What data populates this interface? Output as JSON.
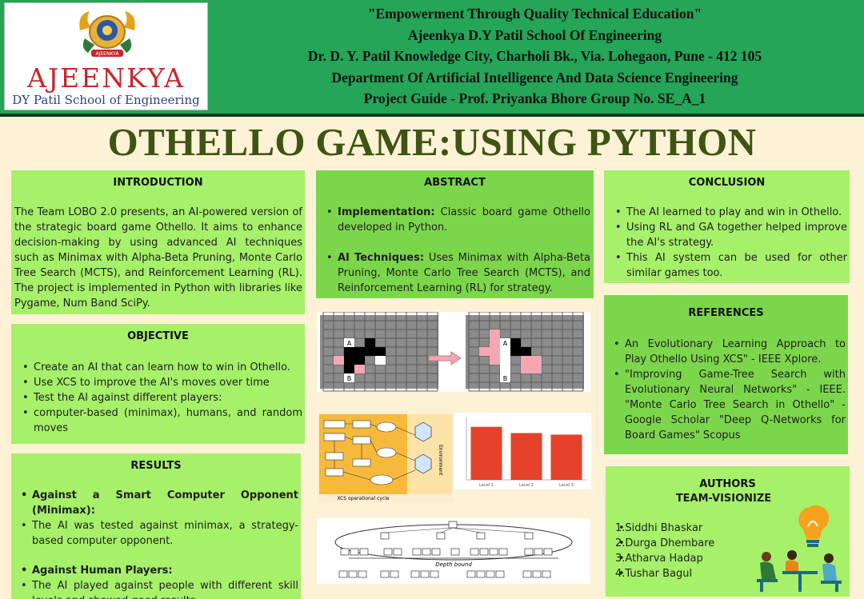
{
  "header": {
    "logo": {
      "brand": "AJEENKYA",
      "subtitle": "DY Patil School of Engineering",
      "badge_text": "AJEENKYA"
    },
    "lines": [
      "\"Empowerment Through Quality Technical Education\"",
      "Ajeenkya D.Y Patil School Of Engineering",
      "Dr. D. Y. Patil Knowledge City, Charholi Bk., Via. Lohegaon, Pune - 412 105",
      "Department Of Artificial Intelligence And Data Science Engineering",
      "Project Guide - Prof. Priyanka Bhore Group No. SE_A_1"
    ]
  },
  "title": "OTHELLO GAME:USING PYTHON",
  "introduction": {
    "heading": "INTRODUCTION",
    "text": "The Team LOBO 2.0 presents, an AI-powered version of the strategic board game Othello. It aims to enhance decision-making by using advanced AI techniques such as Minimax with Alpha-Beta Pruning, Monte Carlo Tree Search (MCTS), and Reinforcement Learning (RL). The project is implemented in Python with libraries like Pygame, Num Band SciPy."
  },
  "objective": {
    "heading": "OBJECTIVE",
    "items": [
      "Create an AI that can learn how to win in Othello.",
      "Use XCS to improve the AI's moves over time",
      "Test the AI against different players:",
      "computer-based (minimax), humans, and random moves"
    ]
  },
  "results": {
    "heading": "RESULTS",
    "groups": [
      {
        "title": "Against a Smart Computer Opponent (Minimax):",
        "detail": "The AI was tested against minimax, a strategy-based computer opponent."
      },
      {
        "title": "Against Human Players:",
        "detail": "The AI played against people with different skill levels and showed good results."
      }
    ]
  },
  "abstract": {
    "heading": "ABSTRACT",
    "items": [
      {
        "label": "Implementation:",
        "text": " Classic board game Othello developed in Python."
      },
      {
        "label": "AI Techniques:",
        "text": " Uses Minimax with Alpha-Beta Pruning, Monte Carlo Tree Search (MCTS), and Reinforcement Learning (RL) for strategy."
      }
    ]
  },
  "conclusion": {
    "heading": "CONCLUSION",
    "items": [
      "The AI learned to play and win in Othello.",
      "Using RL and GA together helped improve the AI's strategy.",
      "This AI system can be used for other similar games too."
    ]
  },
  "references": {
    "heading": "REFERENCES",
    "items": [
      "An Evolutionary Learning Approach to Play Othello Using XCS\" - IEEE Xplore.",
      "\"Improving Game-Tree Search with Evolutionary Neural Networks\" - IEEE. \"Monte Carlo Tree Search in Othello\" - Google Scholar \"Deep Q-Networks for Board Games\" Scopus"
    ]
  },
  "authors": {
    "heading": "AUTHORS",
    "team": "TEAM-VISIONIZE",
    "names": [
      "1.Siddhi Bhaskar",
      "2.Durga Dhembare",
      "3.Atharva Hadap",
      "4.Tushar Bagul"
    ]
  },
  "figures": {
    "board_labels": {
      "a": "A",
      "b": "B"
    },
    "xcs_caption": "XCS operational cycle",
    "environment_label": "Environment",
    "tree_caption": "Depth bound",
    "chart": {
      "type": "bar",
      "categories": [
        "Level 1",
        "Level 2",
        "Level 3"
      ],
      "values": [
        68,
        60,
        58
      ],
      "ylim": [
        0,
        80
      ],
      "bar_color": "#e5412a"
    }
  },
  "colors": {
    "header_green": "#24a557",
    "panel_light": "#a6f06a",
    "panel_mid": "#7cd64c",
    "title": "#3d5512",
    "background": "#fdf1d6"
  }
}
